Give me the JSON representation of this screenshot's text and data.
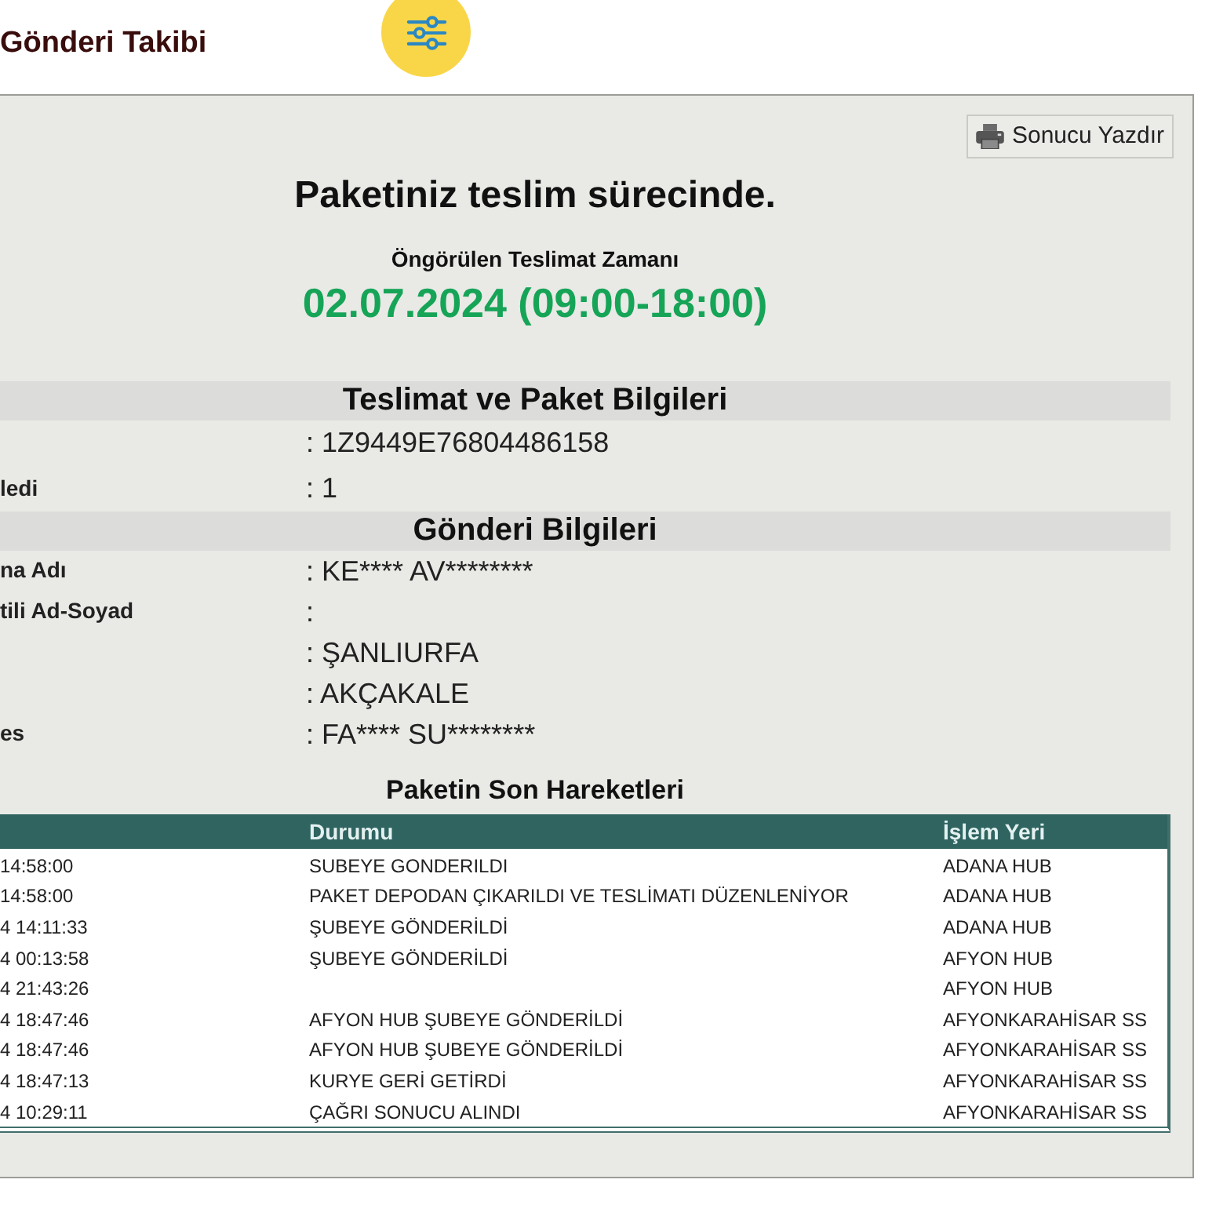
{
  "header": {
    "title": "Gönderi Takibi"
  },
  "print_button": {
    "label": "Sonucu Yazdır"
  },
  "status": {
    "title": "Paketiniz teslim sürecinde.",
    "estimate_label": "Öngörülen Teslimat Zamanı",
    "estimate_value": "02.07.2024 (09:00-18:00)"
  },
  "sections": [
    {
      "title": "Teslimat ve Paket Bilgileri",
      "rows": [
        {
          "value": ": 1Z9449E76804486158"
        },
        {
          "label": "ledi",
          "value": ": 1"
        }
      ]
    },
    {
      "title": "Gönderi Bilgileri",
      "rows": [
        {
          "label": "na Adı",
          "value": ": KE**** AV********"
        },
        {
          "label": "tili Ad-Soyad",
          "value": ":"
        },
        {
          "value": ": ŞANLIURFA"
        },
        {
          "value": ": AKÇAKALE"
        },
        {
          "label": "es",
          "value": ": FA**** SU********"
        }
      ]
    }
  ],
  "movements": {
    "title": "Paketin Son Hareketleri",
    "columns": [
      "Durumu",
      "İşlem Yeri"
    ],
    "rows": [
      {
        "column_1": "14:58:00",
        "durumu": "SUBEYE GONDERILDI",
        "islem_yeri": "ADANA HUB"
      },
      {
        "column_1": "14:58:00",
        "durumu": "PAKET DEPODAN ÇIKARILDI VE TESLİMATI DÜZENLENİYOR",
        "islem_yeri": "ADANA HUB"
      },
      {
        "column_1": "4 14:11:33",
        "durumu": "ŞUBEYE GÖNDERİLDİ",
        "islem_yeri": "ADANA HUB"
      },
      {
        "column_1": "4 00:13:58",
        "durumu": "ŞUBEYE GÖNDERİLDİ",
        "islem_yeri": "AFYON HUB"
      },
      {
        "column_1": "4 21:43:26",
        "islem_yeri": "AFYON HUB"
      },
      {
        "column_1": "4 18:47:46",
        "durumu": "AFYON HUB ŞUBEYE GÖNDERİLDİ",
        "islem_yeri": "AFYONKARAHİSAR SS"
      },
      {
        "column_1": "4 18:47:46",
        "durumu": "AFYON HUB ŞUBEYE GÖNDERİLDİ",
        "islem_yeri": "AFYONKARAHİSAR SS"
      },
      {
        "column_1": "4 18:47:13",
        "durumu": "KURYE GERİ GETİRDİ",
        "islem_yeri": "AFYONKARAHİSAR SS"
      },
      {
        "column_1": "4 10:29:11",
        "durumu": "ÇAĞRI SONUCU ALINDI",
        "islem_yeri": "AFYONKARAHİSAR SS"
      }
    ]
  }
}
